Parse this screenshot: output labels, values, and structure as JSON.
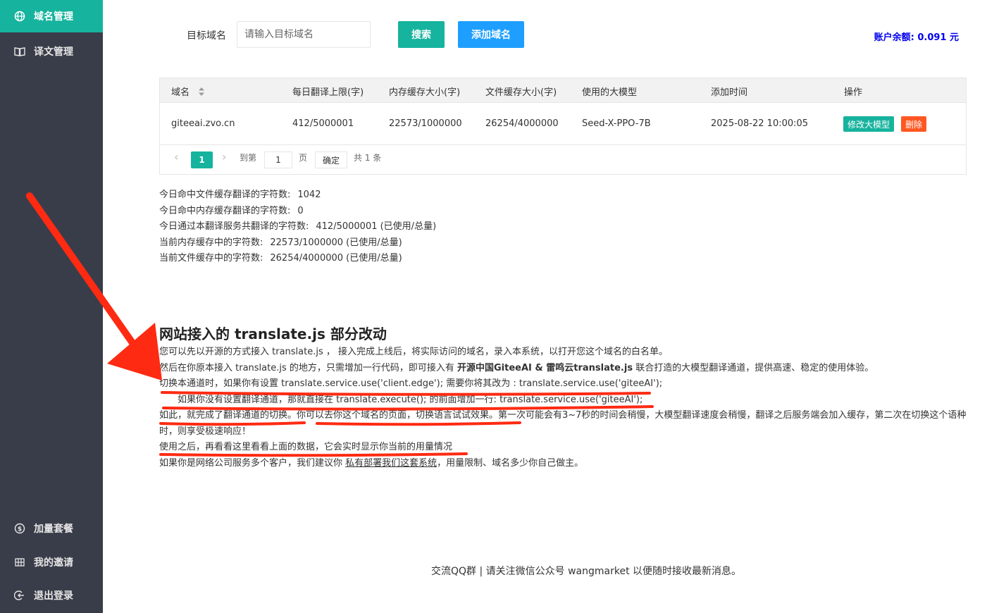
{
  "sidebar": {
    "top_items": [
      {
        "label": "域名管理",
        "icon": "globe-icon",
        "active": true
      },
      {
        "label": "译文管理",
        "icon": "book-icon",
        "active": false
      }
    ],
    "bottom_items": [
      {
        "label": "加量套餐",
        "icon": "dollar-icon"
      },
      {
        "label": "我的邀请",
        "icon": "grid-icon"
      },
      {
        "label": "退出登录",
        "icon": "logout-icon"
      }
    ]
  },
  "search": {
    "label": "目标域名",
    "placeholder": "请输入目标域名",
    "search_button": "搜索",
    "add_button": "添加域名"
  },
  "balance": {
    "label": "账户余额: 0.091 元"
  },
  "table": {
    "headers": [
      "域名",
      "每日翻译上限(字)",
      "内存缓存大小(字)",
      "文件缓存大小(字)",
      "使用的大模型",
      "添加时间",
      "操作"
    ],
    "rows": [
      {
        "domain": "giteeai.zvo.cn",
        "daily_limit": "412/5000001",
        "memory_cache": "22573/1000000",
        "file_cache": "26254/4000000",
        "model": "Seed-X-PPO-7B",
        "added": "2025-08-22 10:00:05",
        "edit_label": "修改大模型",
        "delete_label": "删除"
      }
    ]
  },
  "pager": {
    "prev": "‹",
    "current": "1",
    "next": "›",
    "goto_label": "到第",
    "goto_value": "1",
    "page_unit": "页",
    "confirm": "确定",
    "total": "共 1 条"
  },
  "stats": [
    {
      "label": "今日命中文件缓存翻译的字符数:",
      "value": "1042"
    },
    {
      "label": "今日命中内存缓存翻译的字符数:",
      "value": "0"
    },
    {
      "label": "今日通过本翻译服务共翻译的字符数:",
      "value": "412/5000001 (已使用/总量)"
    },
    {
      "label": "当前内存缓存中的字符数:",
      "value": "22573/1000000 (已使用/总量)"
    },
    {
      "label": "当前文件缓存中的字符数:",
      "value": "26254/4000000 (已使用/总量)"
    }
  ],
  "guide": {
    "title": "网站接入的 translate.js 部分改动",
    "p1": "您可以先以开源的方式接入 translate.js ， 接入完成上线后，将实际访问的域名，录入本系统，以打开您这个域名的白名单。",
    "p2_a": "然后在你原本接入 translate.js 的地方，只需增加一行代码，即可接入有 ",
    "p2_b": "开源中国GiteeAI & 雷鸣云translate.js",
    "p2_c": " 联合打造的大模型翻译通道，提供高速、稳定的使用体验。",
    "p3": "切换本通道时，如果你有设置 translate.service.use('client.edge'); 需要你将其改为 : translate.service.use('giteeAI');",
    "p4": "如果你没有设置翻译通道，那就直接在 translate.execute(); 的前面增加一行: translate.service.use('giteeAI');",
    "p5": "如此，就完成了翻译通道的切换。你可以去你这个域名的页面，切换语言试试效果。第一次可能会有3~7秒的时间会稍慢，大模型翻译速度会稍慢，翻译之后服务端会加入缓存，第二次在切换这个语种时，则享受极速响应！",
    "p6": "使用之后，再看看这里看看上面的数据，它会实时显示你当前的用量情况",
    "p7_a": "如果你是网络公司服务多个客户，我们建议你 ",
    "p7_b": "私有部署我们这套系统",
    "p7_c": "，用量限制、域名多少你自己做主。"
  },
  "footer": "交流QQ群 | 请关注微信公众号 wangmarket 以便随时接收最新消息。",
  "colors": {
    "sidebar_bg": "#393d49",
    "accent": "#16b39e",
    "blue": "#1e9fff",
    "danger": "#ff5722",
    "annotation": "#ff2a12"
  }
}
